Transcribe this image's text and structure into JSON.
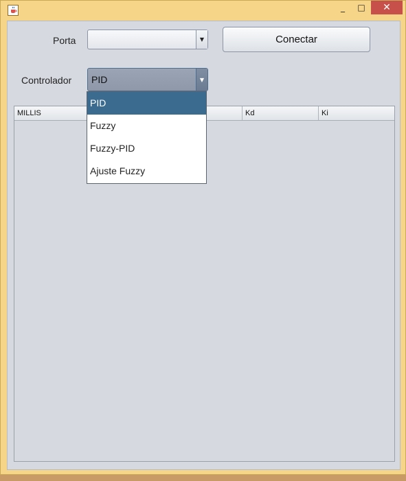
{
  "window": {
    "icon": "java-cup-icon",
    "controls": {
      "minimize": "_",
      "maximize": "□",
      "close": "✕"
    }
  },
  "form": {
    "porta_label": "Porta",
    "porta_value": "",
    "conectar_label": "Conectar",
    "controlador_label": "Controlador",
    "controlador_value": "PID"
  },
  "table": {
    "columns": [
      "MILLIS",
      "Kd",
      "Ki"
    ]
  },
  "dropdown": {
    "options": [
      "PID",
      "Fuzzy",
      "Fuzzy-PID",
      "Ajuste Fuzzy"
    ],
    "selected_index": 0
  },
  "colors": {
    "titlebar": "#f6d588",
    "close_button": "#c7504a",
    "selection": "#3b6b8f",
    "panel": "#d6d9df"
  }
}
